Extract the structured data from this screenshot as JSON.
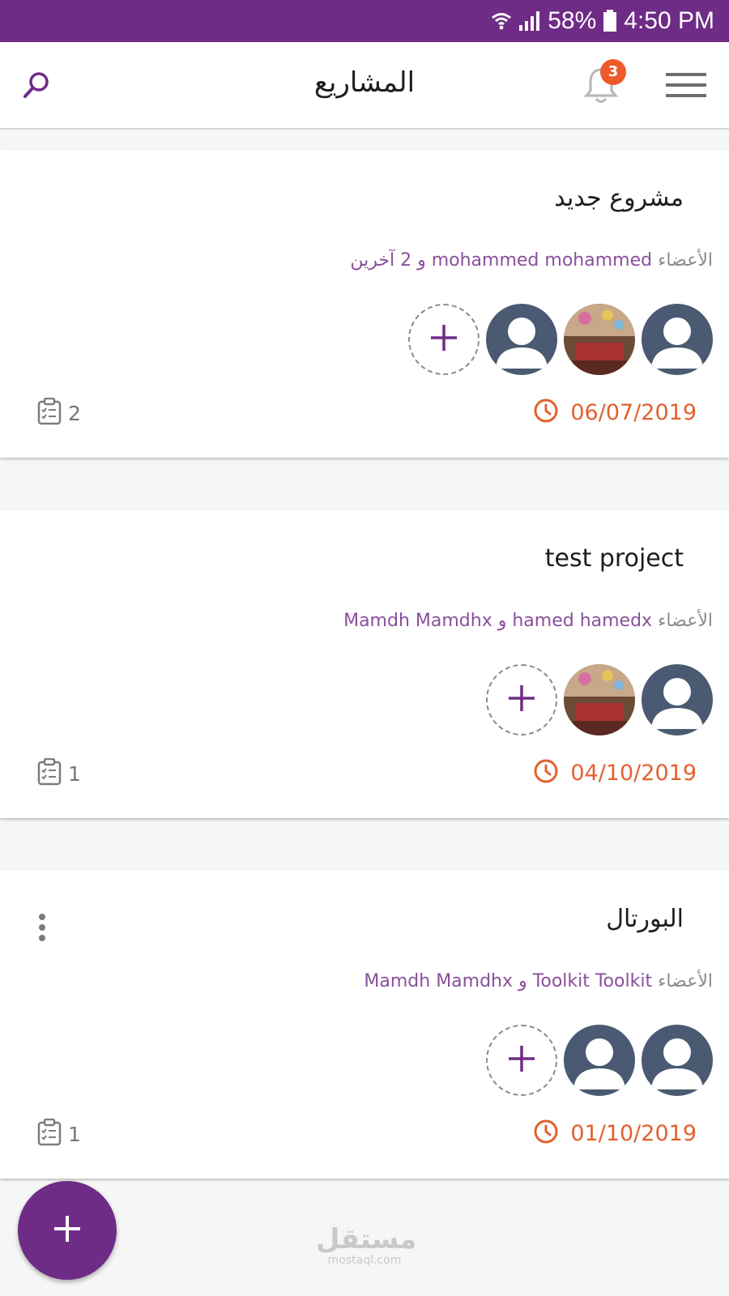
{
  "status_bar": {
    "battery": "58%",
    "time": "4:50 PM"
  },
  "app_bar": {
    "title": "المشاريع",
    "notification_count": "3",
    "icons": [
      "menu-icon",
      "bell-icon",
      "search-icon"
    ]
  },
  "projects": [
    {
      "title": "مشروع جديد",
      "members_label": "الأعضاء",
      "members_text": "mohammed mohammed و 2 آخرين",
      "avatars": [
        "default-avatar",
        "photo-avatar",
        "default-avatar"
      ],
      "date": "06/07/2019",
      "task_count": "2",
      "has_more_menu": false
    },
    {
      "title": "test project",
      "members_label": "الأعضاء",
      "members_text": "hamed hamedx و Mamdh Mamdhx",
      "avatars": [
        "default-avatar",
        "photo-avatar"
      ],
      "date": "04/10/2019",
      "task_count": "1",
      "has_more_menu": false
    },
    {
      "title": "البورتال",
      "members_label": "الأعضاء",
      "members_text": "Toolkit Toolkit و Mamdh Mamdhx",
      "avatars": [
        "default-avatar",
        "default-avatar"
      ],
      "date": "01/10/2019",
      "task_count": "1",
      "has_more_menu": true
    }
  ],
  "watermark": {
    "arabic": "مستقل",
    "latin": "mostaql.com"
  },
  "colors": {
    "primary": "#6f2c86",
    "accent_date": "#e2612f",
    "badge": "#ef5a2b",
    "avatar_bg": "#4a5a72",
    "members_text": "#8a4f9c"
  }
}
